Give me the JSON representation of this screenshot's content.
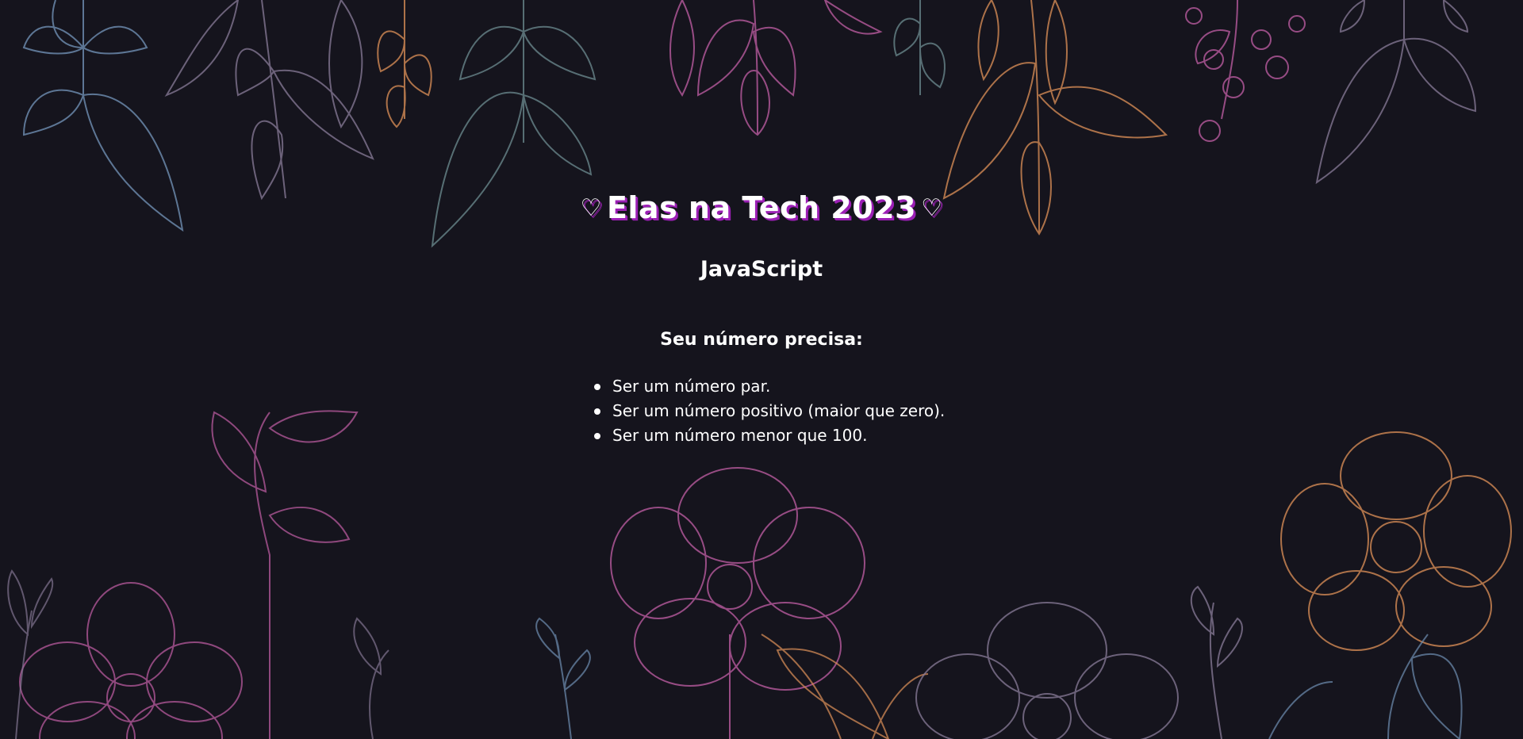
{
  "page": {
    "heart_left": "♡",
    "title": "Elas na Tech 2023",
    "heart_right": "♡",
    "subtitle": "JavaScript"
  },
  "requirements": {
    "heading": "Seu número precisa:",
    "items": [
      "Ser um número par.",
      "Ser um número positivo (maior que zero).",
      "Ser um número menor que 100."
    ]
  },
  "background": {
    "base_color": "#15141d",
    "illustration": "floral-line-art",
    "palette": [
      "#6f8fb3",
      "#b85a9e",
      "#d38a55",
      "#8a7c9a",
      "#6e8d92"
    ]
  },
  "colors": {
    "title_shadow": "#9b1fb5",
    "text": "#ffffff"
  }
}
